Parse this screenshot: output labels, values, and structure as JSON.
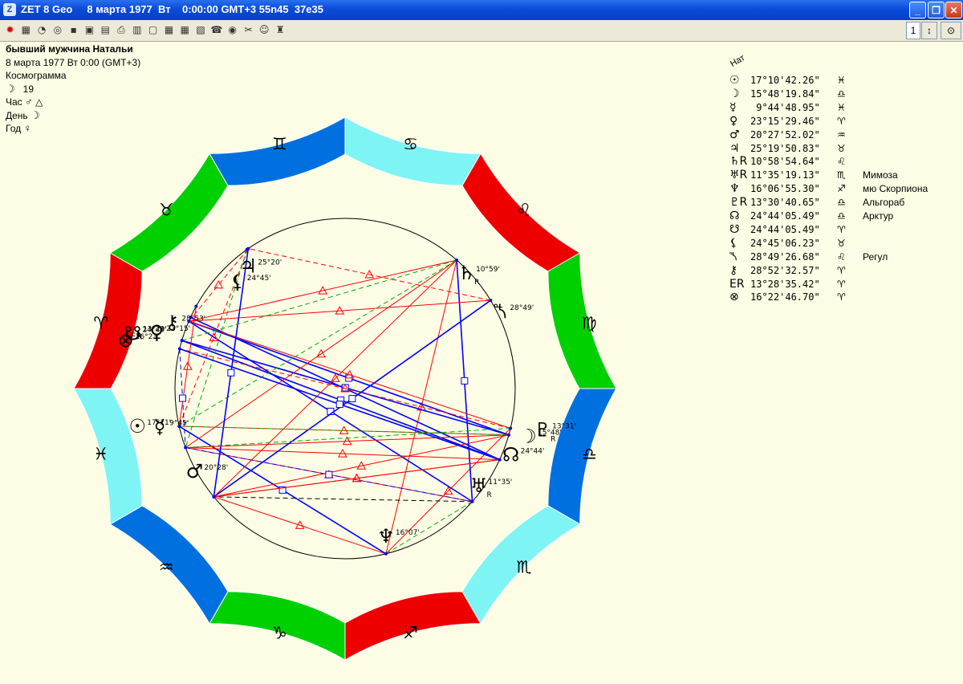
{
  "window": {
    "title": "ZET 8 Geo     8 марта 1977  Вт    0:00:00 GMT+3 55n45  37e35",
    "app_icon": "Z",
    "spinner_value": "1"
  },
  "toolbar": {
    "icons": [
      "red-circle-icon",
      "table-icon",
      "compass-icon",
      "circle-chart-icon",
      "night-sky-icon",
      "starfield-icon",
      "map-icon",
      "printer-icon",
      "book-icon",
      "document-icon",
      "grid-icon",
      "grid-red-icon",
      "chart-icon",
      "phone-icon",
      "target-icon",
      "tools-icon",
      "person-icon",
      "figure-icon"
    ]
  },
  "person": {
    "name": "бывший мужчина Натальи",
    "date": "8 марта 1977  Вт   0:00 (GMT+3)",
    "chart_type": "Космограмма",
    "moon_day_symbol": "☽",
    "moon_day": "19",
    "hour_label": "Час",
    "hour_symbol": "♂",
    "hour_aspect": "△",
    "day_label": "День",
    "day_symbol": "☽",
    "year_label": "Год",
    "year_symbol": "♀"
  },
  "planet_table": {
    "header": "Нат",
    "rows": [
      {
        "glyph": "☉",
        "value": "17°10'42.26\"",
        "sign": "♓",
        "star": ""
      },
      {
        "glyph": "☽",
        "value": "15°48'19.84\"",
        "sign": "♎",
        "star": ""
      },
      {
        "glyph": "☿",
        "value": " 9°44'48.95\"",
        "sign": "♓",
        "star": ""
      },
      {
        "glyph": "♀",
        "value": "23°15'29.46\"",
        "sign": "♈",
        "star": ""
      },
      {
        "glyph": "♂",
        "value": "20°27'52.02\"",
        "sign": "♒",
        "star": ""
      },
      {
        "glyph": "♃",
        "value": "25°19'50.83\"",
        "sign": "♉",
        "star": ""
      },
      {
        "glyph": "♄R",
        "value": "10°58'54.64\"",
        "sign": "♌",
        "star": ""
      },
      {
        "glyph": "♅R",
        "value": "11°35'19.13\"",
        "sign": "♏",
        "star": "Мимоза"
      },
      {
        "glyph": "♆",
        "value": "16°06'55.30\"",
        "sign": "♐",
        "star": "мю Скорпиона"
      },
      {
        "glyph": "♇R",
        "value": "13°30'40.65\"",
        "sign": "♎",
        "star": "Альгораб"
      },
      {
        "glyph": "☊",
        "value": "24°44'05.49\"",
        "sign": "♎",
        "star": "Арктур"
      },
      {
        "glyph": "☋",
        "value": "24°44'05.49\"",
        "sign": "♈",
        "star": ""
      },
      {
        "glyph": "⚸",
        "value": "24°45'06.23\"",
        "sign": "♉",
        "star": ""
      },
      {
        "glyph": "⯲",
        "value": "28°49'26.68\"",
        "sign": "♌",
        "star": "Регул"
      },
      {
        "glyph": "⚷",
        "value": "28°52'32.57\"",
        "sign": "♈",
        "star": ""
      },
      {
        "glyph": "ER",
        "value": "13°28'35.42\"",
        "sign": "♈",
        "star": ""
      },
      {
        "glyph": "⊗",
        "value": "16°22'46.70\"",
        "sign": "♈",
        "star": ""
      }
    ]
  },
  "zodiac": [
    {
      "glyph": "♈",
      "color": "#ef0000"
    },
    {
      "glyph": "♉",
      "color": "#00d000"
    },
    {
      "glyph": "♊",
      "color": "#0070e0"
    },
    {
      "glyph": "♋",
      "color": "#7ff4f4"
    },
    {
      "glyph": "♌",
      "color": "#ef0000"
    },
    {
      "glyph": "♍",
      "color": "#00d000"
    },
    {
      "glyph": "♎",
      "color": "#0070e0"
    },
    {
      "glyph": "♏",
      "color": "#7ff4f4"
    },
    {
      "glyph": "♐",
      "color": "#ef0000"
    },
    {
      "glyph": "♑",
      "color": "#00d000"
    },
    {
      "glyph": "♒",
      "color": "#0070e0"
    },
    {
      "glyph": "♓",
      "color": "#7ff4f4"
    }
  ],
  "chart_planets": [
    {
      "glyph": "♆",
      "label": "16°07'",
      "lon": 256.1,
      "r": ""
    },
    {
      "glyph": "♅",
      "label": "11°35'",
      "lon": 221.6,
      "r": "R"
    },
    {
      "glyph": "☊",
      "label": "24°44'",
      "lon": 204.7,
      "r": ""
    },
    {
      "glyph": "☽",
      "label": "15°48'",
      "lon": 195.8,
      "r": ""
    },
    {
      "glyph": "♇",
      "label": "13°31'",
      "lon": 193.5,
      "r": "R"
    },
    {
      "glyph": "⯲",
      "label": "28°49'",
      "lon": 148.8,
      "r": ""
    },
    {
      "glyph": "♄",
      "label": "10°59'",
      "lon": 131.0,
      "r": "R"
    },
    {
      "glyph": "♃",
      "label": "25°20'",
      "lon": 55.3,
      "r": ""
    },
    {
      "glyph": "⚸",
      "label": "24°45'",
      "lon": 54.8,
      "r": ""
    },
    {
      "glyph": "⚷",
      "label": "28°53'",
      "lon": 28.9,
      "r": ""
    },
    {
      "glyph": "☋",
      "label": "24°44'",
      "lon": 24.7,
      "r": ""
    },
    {
      "glyph": "♀",
      "label": "23°15'",
      "lon": 23.3,
      "r": ""
    },
    {
      "glyph": "⊗",
      "label": "16°23'",
      "lon": 16.4,
      "r": ""
    },
    {
      "glyph": "ER",
      "label": "13°29'",
      "lon": 13.5,
      "r": ""
    },
    {
      "glyph": "☉",
      "label": "17°11'",
      "lon": 347.2,
      "r": ""
    },
    {
      "glyph": "☿",
      "label": "9°45'",
      "lon": 339.7,
      "r": ""
    },
    {
      "glyph": "♂",
      "label": "20°28'",
      "lon": 320.5,
      "r": ""
    }
  ],
  "aspects": [
    {
      "a": 0,
      "b": 4,
      "color": "#ff0000",
      "style": "solid"
    },
    {
      "a": 0,
      "b": 16,
      "color": "#ff0000",
      "style": "solid"
    },
    {
      "a": 0,
      "b": 14,
      "color": "#0000ff",
      "style": "solid"
    },
    {
      "a": 0,
      "b": 6,
      "color": "#ff0000",
      "style": "solid"
    },
    {
      "a": 0,
      "b": 1,
      "color": "#00aa00",
      "style": "dash"
    },
    {
      "a": 1,
      "b": 16,
      "color": "#000000",
      "style": "dash"
    },
    {
      "a": 1,
      "b": 6,
      "color": "#0000ff",
      "style": "solid"
    },
    {
      "a": 1,
      "b": 11,
      "color": "#0000ff",
      "style": "solid"
    },
    {
      "a": 1,
      "b": 15,
      "color": "#ff0000",
      "style": "solid"
    },
    {
      "a": 2,
      "b": 12,
      "color": "#0000ff",
      "style": "solid"
    },
    {
      "a": 2,
      "b": 10,
      "color": "#0000ff",
      "style": "solid"
    },
    {
      "a": 2,
      "b": 15,
      "color": "#ff0000",
      "style": "solid"
    },
    {
      "a": 2,
      "b": 16,
      "color": "#ff0000",
      "style": "solid"
    },
    {
      "a": 3,
      "b": 11,
      "color": "#0000ff",
      "style": "solid"
    },
    {
      "a": 3,
      "b": 12,
      "color": "#0000ff",
      "style": "solid"
    },
    {
      "a": 3,
      "b": 14,
      "color": "#ff0000",
      "style": "dash"
    },
    {
      "a": 3,
      "b": 16,
      "color": "#ff0000",
      "style": "solid"
    },
    {
      "a": 3,
      "b": 15,
      "color": "#ff0000",
      "style": "solid"
    },
    {
      "a": 4,
      "b": 13,
      "color": "#ff0000",
      "style": "dash"
    },
    {
      "a": 4,
      "b": 11,
      "color": "#ff0000",
      "style": "solid"
    },
    {
      "a": 5,
      "b": 7,
      "color": "#ff0000",
      "style": "dash"
    },
    {
      "a": 5,
      "b": 16,
      "color": "#0000ff",
      "style": "solid"
    },
    {
      "a": 5,
      "b": 11,
      "color": "#ff0000",
      "style": "solid"
    },
    {
      "a": 6,
      "b": 15,
      "color": "#ff0000",
      "style": "solid"
    },
    {
      "a": 6,
      "b": 14,
      "color": "#00aa00",
      "style": "dash"
    },
    {
      "a": 6,
      "b": 11,
      "color": "#ff0000",
      "style": "solid"
    },
    {
      "a": 6,
      "b": 16,
      "color": "#ff0000",
      "style": "solid"
    },
    {
      "a": 7,
      "b": 16,
      "color": "#0000ff",
      "style": "solid"
    },
    {
      "a": 7,
      "b": 14,
      "color": "#ff0000",
      "style": "dash"
    },
    {
      "a": 8,
      "b": 15,
      "color": "#00aa00",
      "style": "dash"
    },
    {
      "a": 9,
      "b": 14,
      "color": "#ff0000",
      "style": "solid"
    },
    {
      "a": 13,
      "b": 2,
      "color": "#0000ff",
      "style": "solid"
    },
    {
      "a": 14,
      "b": 3,
      "color": "#00aa00",
      "style": "dash"
    },
    {
      "a": 15,
      "b": 4,
      "color": "#00aa00",
      "style": "dash"
    },
    {
      "a": 15,
      "b": 1,
      "color": "#0000ff",
      "style": "dash"
    },
    {
      "a": 16,
      "b": 2,
      "color": "#ff0000",
      "style": "solid"
    },
    {
      "a": 11,
      "b": 7,
      "color": "#ff0000",
      "style": "dash"
    },
    {
      "a": 12,
      "b": 6,
      "color": "#00aa00",
      "style": "dash"
    },
    {
      "a": 13,
      "b": 15,
      "color": "#0000ff",
      "style": "dash"
    }
  ]
}
